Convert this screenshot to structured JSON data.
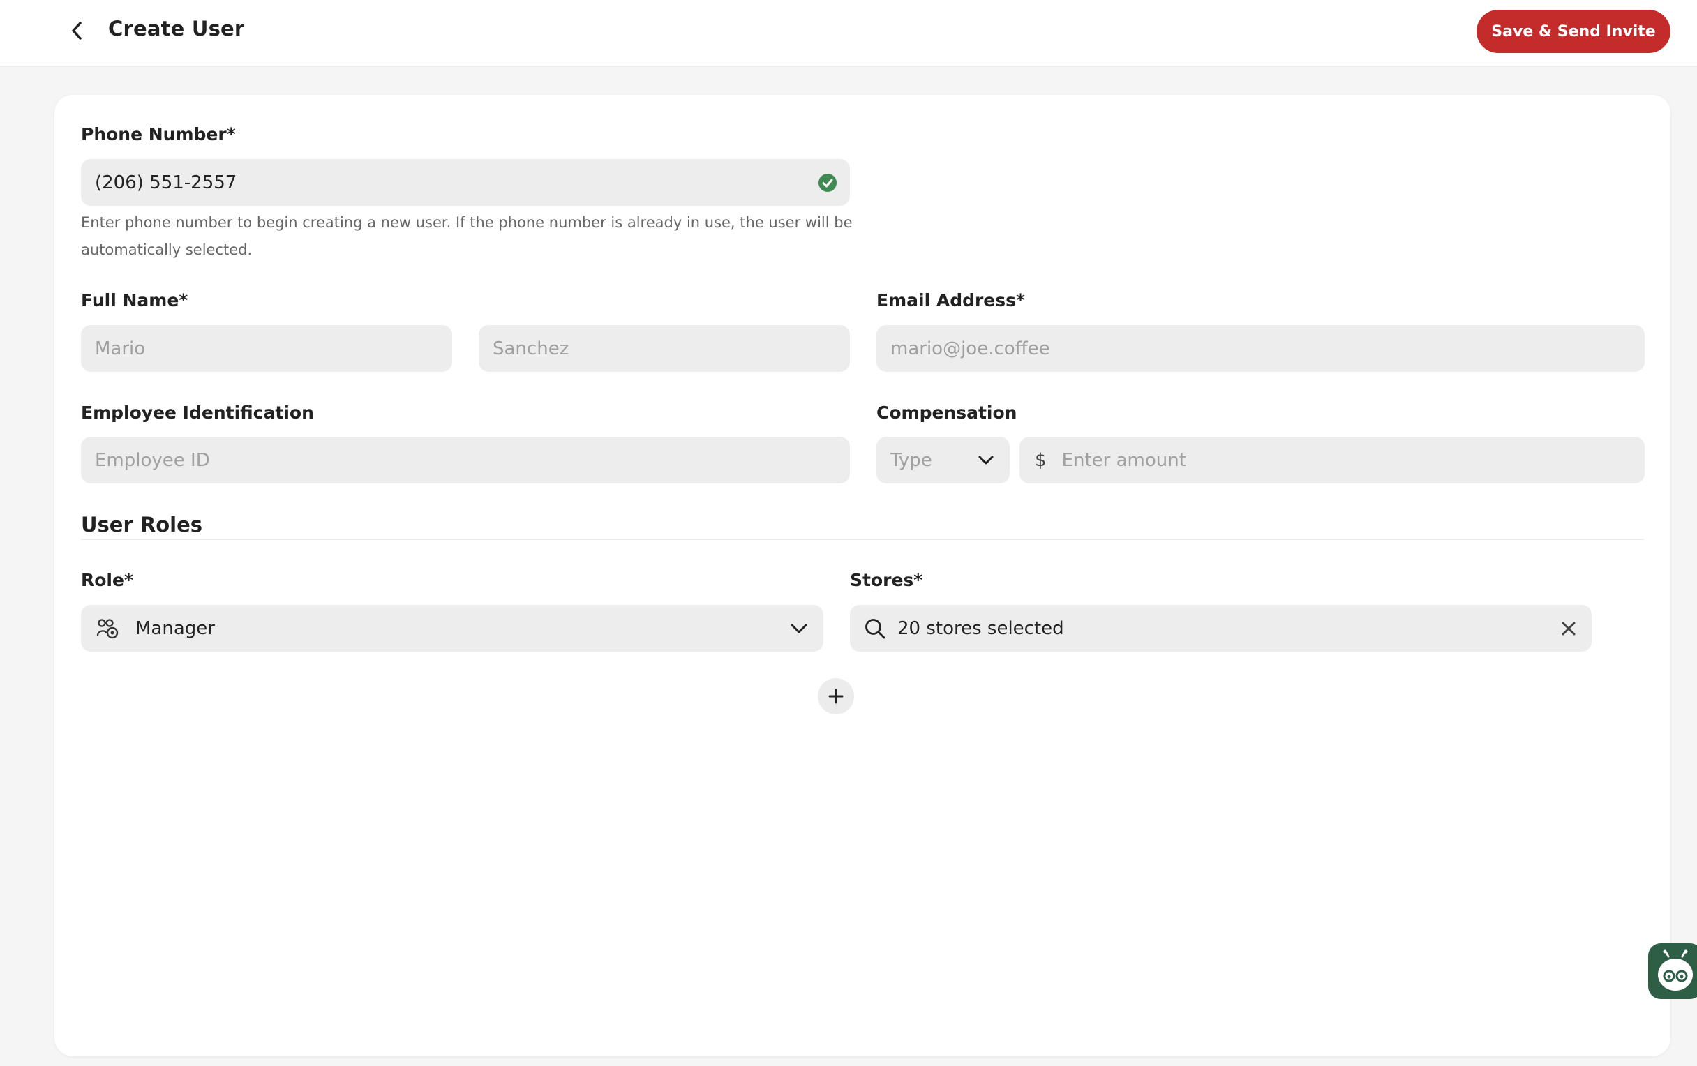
{
  "header": {
    "title": "Create User",
    "save_label": "Save & Send Invite"
  },
  "form": {
    "phone": {
      "label": "Phone Number*",
      "value": "(206) 551-2557",
      "helper": "Enter phone number to begin creating a new user. If the phone number is already in use, the user will be automatically selected."
    },
    "full_name": {
      "label": "Full Name*",
      "first_placeholder": "Mario",
      "last_placeholder": "Sanchez"
    },
    "email": {
      "label": "Email Address*",
      "placeholder": "mario@joe.coffee"
    },
    "employee_id": {
      "label": "Employee Identification",
      "placeholder": "Employee ID"
    },
    "compensation": {
      "label": "Compensation",
      "type_placeholder": "Type",
      "currency_symbol": "$",
      "amount_placeholder": "Enter amount"
    }
  },
  "roles": {
    "section_title": "User Roles",
    "role_label": "Role*",
    "role_value": "Manager",
    "stores_label": "Stores*",
    "stores_value": "20 stores selected"
  },
  "colors": {
    "primary": "#c42b2b",
    "success": "#3f8a52",
    "widget": "#2e5e45"
  }
}
